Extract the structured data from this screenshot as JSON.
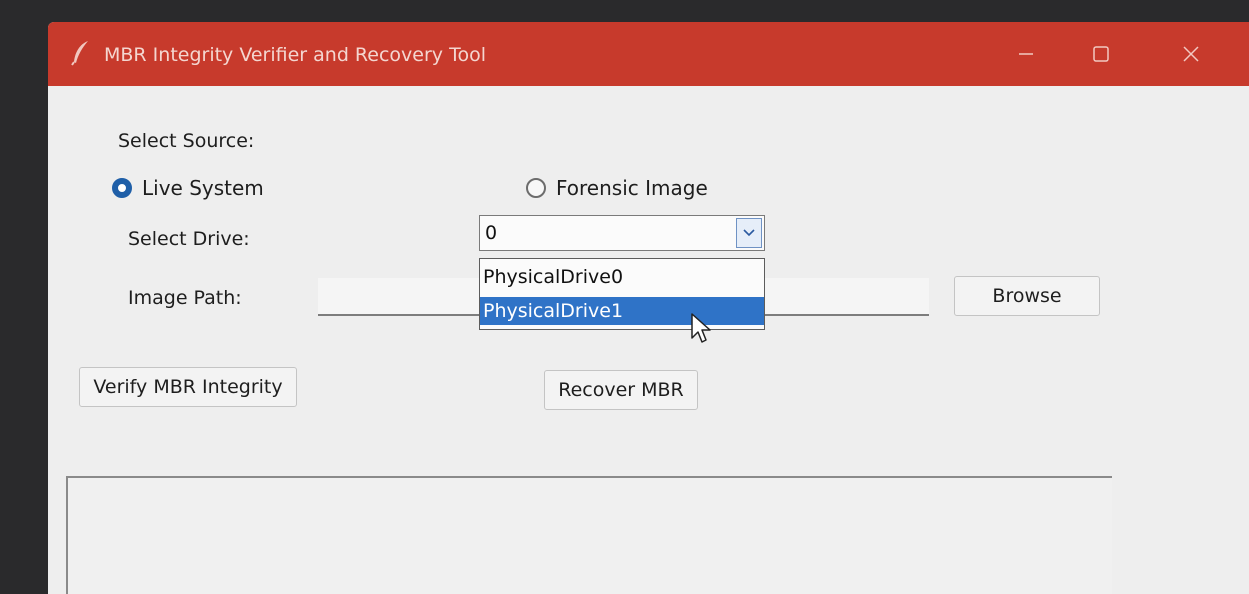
{
  "window": {
    "title": "MBR Integrity Verifier and Recovery Tool",
    "titlebar_color": "#c73a2c",
    "controls": {
      "minimize_icon": "minimize-icon",
      "maximize_icon": "maximize-icon",
      "close_icon": "close-icon"
    }
  },
  "source": {
    "label": "Select Source:",
    "options": [
      {
        "label": "Live System",
        "selected": true
      },
      {
        "label": "Forensic Image",
        "selected": false
      }
    ]
  },
  "drive": {
    "label": "Select Drive:",
    "value": "0",
    "dropdown_open": true,
    "options": [
      "PhysicalDrive0",
      "PhysicalDrive1"
    ],
    "highlighted_option": "PhysicalDrive1"
  },
  "image_path": {
    "label": "Image Path:",
    "value": "",
    "browse_label": "Browse"
  },
  "actions": {
    "verify_label": "Verify MBR Integrity",
    "recover_label": "Recover MBR"
  },
  "output": {
    "text": ""
  },
  "colors": {
    "selection": "#2f73c7",
    "radio_selected": "#1f5fa8",
    "window_bg": "#eeeeee"
  }
}
